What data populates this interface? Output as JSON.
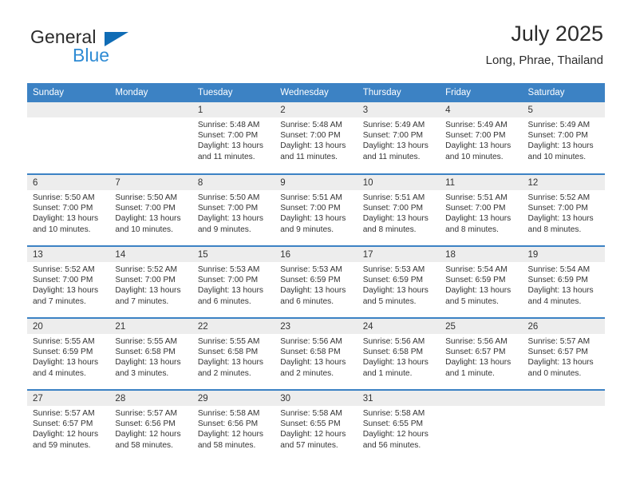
{
  "brand": {
    "name_part1": "General",
    "name_part2": "Blue",
    "flag_icon": "triangle-flag-icon",
    "accent_color": "#0f6cb5",
    "secondary_color": "#2e8bd4"
  },
  "header": {
    "title": "July 2025",
    "subtitle": "Long, Phrae, Thailand"
  },
  "calendar": {
    "header_bg": "#3c82c4",
    "daynum_bg": "#ededed",
    "weekday_names": [
      "Sunday",
      "Monday",
      "Tuesday",
      "Wednesday",
      "Thursday",
      "Friday",
      "Saturday"
    ],
    "weeks": [
      [
        {
          "day": "",
          "sunrise": "",
          "sunset": "",
          "daylight": ""
        },
        {
          "day": "",
          "sunrise": "",
          "sunset": "",
          "daylight": ""
        },
        {
          "day": "1",
          "sunrise": "Sunrise: 5:48 AM",
          "sunset": "Sunset: 7:00 PM",
          "daylight": "Daylight: 13 hours and 11 minutes."
        },
        {
          "day": "2",
          "sunrise": "Sunrise: 5:48 AM",
          "sunset": "Sunset: 7:00 PM",
          "daylight": "Daylight: 13 hours and 11 minutes."
        },
        {
          "day": "3",
          "sunrise": "Sunrise: 5:49 AM",
          "sunset": "Sunset: 7:00 PM",
          "daylight": "Daylight: 13 hours and 11 minutes."
        },
        {
          "day": "4",
          "sunrise": "Sunrise: 5:49 AM",
          "sunset": "Sunset: 7:00 PM",
          "daylight": "Daylight: 13 hours and 10 minutes."
        },
        {
          "day": "5",
          "sunrise": "Sunrise: 5:49 AM",
          "sunset": "Sunset: 7:00 PM",
          "daylight": "Daylight: 13 hours and 10 minutes."
        }
      ],
      [
        {
          "day": "6",
          "sunrise": "Sunrise: 5:50 AM",
          "sunset": "Sunset: 7:00 PM",
          "daylight": "Daylight: 13 hours and 10 minutes."
        },
        {
          "day": "7",
          "sunrise": "Sunrise: 5:50 AM",
          "sunset": "Sunset: 7:00 PM",
          "daylight": "Daylight: 13 hours and 10 minutes."
        },
        {
          "day": "8",
          "sunrise": "Sunrise: 5:50 AM",
          "sunset": "Sunset: 7:00 PM",
          "daylight": "Daylight: 13 hours and 9 minutes."
        },
        {
          "day": "9",
          "sunrise": "Sunrise: 5:51 AM",
          "sunset": "Sunset: 7:00 PM",
          "daylight": "Daylight: 13 hours and 9 minutes."
        },
        {
          "day": "10",
          "sunrise": "Sunrise: 5:51 AM",
          "sunset": "Sunset: 7:00 PM",
          "daylight": "Daylight: 13 hours and 8 minutes."
        },
        {
          "day": "11",
          "sunrise": "Sunrise: 5:51 AM",
          "sunset": "Sunset: 7:00 PM",
          "daylight": "Daylight: 13 hours and 8 minutes."
        },
        {
          "day": "12",
          "sunrise": "Sunrise: 5:52 AM",
          "sunset": "Sunset: 7:00 PM",
          "daylight": "Daylight: 13 hours and 8 minutes."
        }
      ],
      [
        {
          "day": "13",
          "sunrise": "Sunrise: 5:52 AM",
          "sunset": "Sunset: 7:00 PM",
          "daylight": "Daylight: 13 hours and 7 minutes."
        },
        {
          "day": "14",
          "sunrise": "Sunrise: 5:52 AM",
          "sunset": "Sunset: 7:00 PM",
          "daylight": "Daylight: 13 hours and 7 minutes."
        },
        {
          "day": "15",
          "sunrise": "Sunrise: 5:53 AM",
          "sunset": "Sunset: 7:00 PM",
          "daylight": "Daylight: 13 hours and 6 minutes."
        },
        {
          "day": "16",
          "sunrise": "Sunrise: 5:53 AM",
          "sunset": "Sunset: 6:59 PM",
          "daylight": "Daylight: 13 hours and 6 minutes."
        },
        {
          "day": "17",
          "sunrise": "Sunrise: 5:53 AM",
          "sunset": "Sunset: 6:59 PM",
          "daylight": "Daylight: 13 hours and 5 minutes."
        },
        {
          "day": "18",
          "sunrise": "Sunrise: 5:54 AM",
          "sunset": "Sunset: 6:59 PM",
          "daylight": "Daylight: 13 hours and 5 minutes."
        },
        {
          "day": "19",
          "sunrise": "Sunrise: 5:54 AM",
          "sunset": "Sunset: 6:59 PM",
          "daylight": "Daylight: 13 hours and 4 minutes."
        }
      ],
      [
        {
          "day": "20",
          "sunrise": "Sunrise: 5:55 AM",
          "sunset": "Sunset: 6:59 PM",
          "daylight": "Daylight: 13 hours and 4 minutes."
        },
        {
          "day": "21",
          "sunrise": "Sunrise: 5:55 AM",
          "sunset": "Sunset: 6:58 PM",
          "daylight": "Daylight: 13 hours and 3 minutes."
        },
        {
          "day": "22",
          "sunrise": "Sunrise: 5:55 AM",
          "sunset": "Sunset: 6:58 PM",
          "daylight": "Daylight: 13 hours and 2 minutes."
        },
        {
          "day": "23",
          "sunrise": "Sunrise: 5:56 AM",
          "sunset": "Sunset: 6:58 PM",
          "daylight": "Daylight: 13 hours and 2 minutes."
        },
        {
          "day": "24",
          "sunrise": "Sunrise: 5:56 AM",
          "sunset": "Sunset: 6:58 PM",
          "daylight": "Daylight: 13 hours and 1 minute."
        },
        {
          "day": "25",
          "sunrise": "Sunrise: 5:56 AM",
          "sunset": "Sunset: 6:57 PM",
          "daylight": "Daylight: 13 hours and 1 minute."
        },
        {
          "day": "26",
          "sunrise": "Sunrise: 5:57 AM",
          "sunset": "Sunset: 6:57 PM",
          "daylight": "Daylight: 13 hours and 0 minutes."
        }
      ],
      [
        {
          "day": "27",
          "sunrise": "Sunrise: 5:57 AM",
          "sunset": "Sunset: 6:57 PM",
          "daylight": "Daylight: 12 hours and 59 minutes."
        },
        {
          "day": "28",
          "sunrise": "Sunrise: 5:57 AM",
          "sunset": "Sunset: 6:56 PM",
          "daylight": "Daylight: 12 hours and 58 minutes."
        },
        {
          "day": "29",
          "sunrise": "Sunrise: 5:58 AM",
          "sunset": "Sunset: 6:56 PM",
          "daylight": "Daylight: 12 hours and 58 minutes."
        },
        {
          "day": "30",
          "sunrise": "Sunrise: 5:58 AM",
          "sunset": "Sunset: 6:55 PM",
          "daylight": "Daylight: 12 hours and 57 minutes."
        },
        {
          "day": "31",
          "sunrise": "Sunrise: 5:58 AM",
          "sunset": "Sunset: 6:55 PM",
          "daylight": "Daylight: 12 hours and 56 minutes."
        },
        {
          "day": "",
          "sunrise": "",
          "sunset": "",
          "daylight": ""
        },
        {
          "day": "",
          "sunrise": "",
          "sunset": "",
          "daylight": ""
        }
      ]
    ]
  }
}
